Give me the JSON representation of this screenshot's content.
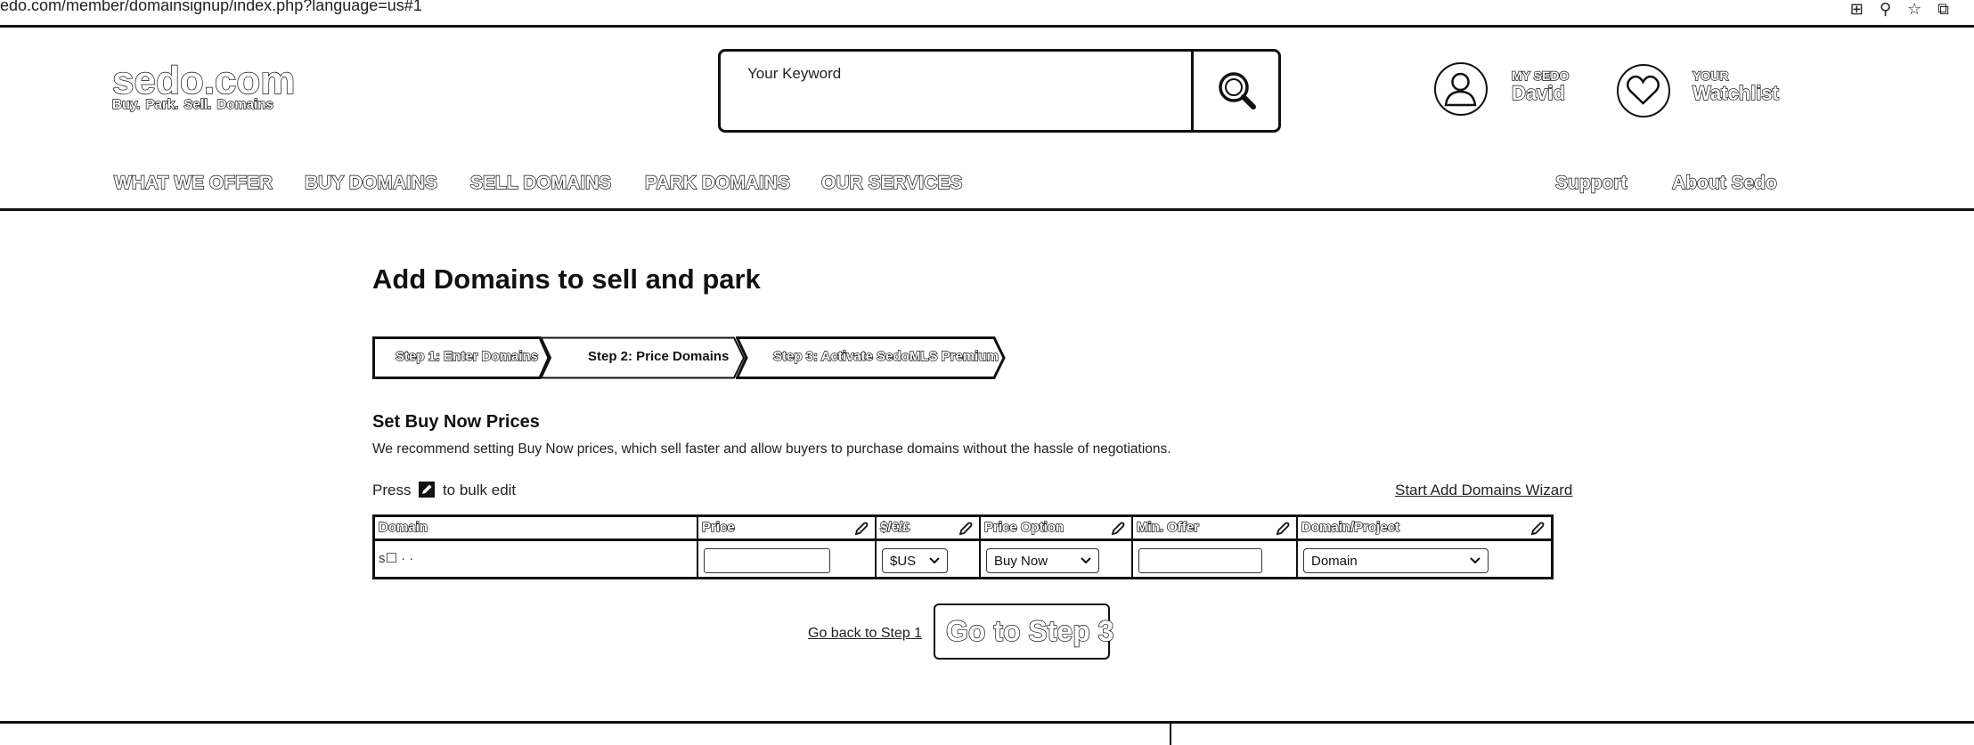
{
  "browser": {
    "url": "edo.com/member/domainsignup/index.php?language=us#1"
  },
  "header": {
    "logo_main": "sedo.com",
    "logo_tagline": "Buy. Park. Sell. Domains",
    "search_placeholder": "Your Keyword",
    "my_sedo_label": "MY SEDO",
    "my_sedo_name": "David",
    "watchlist_top": "YOUR",
    "watchlist_name": "Watchlist"
  },
  "nav": {
    "what_we_offer": "WHAT WE OFFER",
    "buy_domains": "BUY DOMAINS",
    "sell_domains": "SELL DOMAINS",
    "park_domains": "PARK DOMAINS",
    "our_services": "OUR SERVICES",
    "support": "Support",
    "about": "About Sedo"
  },
  "main": {
    "title": "Add Domains to sell and park",
    "steps": [
      {
        "label": "Step 1: Enter Domains",
        "active": false
      },
      {
        "label": "Step 2: Price Domains",
        "active": true
      },
      {
        "label": "Step 3: Activate SedoMLS Premium",
        "active": false
      }
    ],
    "section_title": "Set Buy Now Prices",
    "section_desc": "We recommend setting Buy Now prices, which sell faster and allow buyers to purchase domains without the hassle of negotiations.",
    "press_prefix": "Press",
    "press_suffix": "to bulk edit",
    "wizard_link": "Start Add Domains Wizard",
    "table": {
      "headers": {
        "domain": "Domain",
        "price": "Price",
        "currency": "$/€/£",
        "price_option": "Price Option",
        "min_offer": "Min. Offer",
        "domain_project": "Domain/Project"
      },
      "rows": [
        {
          "domain": "s☐ · ·",
          "price": "",
          "currency": "$US",
          "price_option": "Buy Now",
          "min_offer": "",
          "domain_project": "Domain"
        }
      ]
    },
    "back_link": "Go back to Step 1",
    "next_button": "Go to Step 3"
  }
}
